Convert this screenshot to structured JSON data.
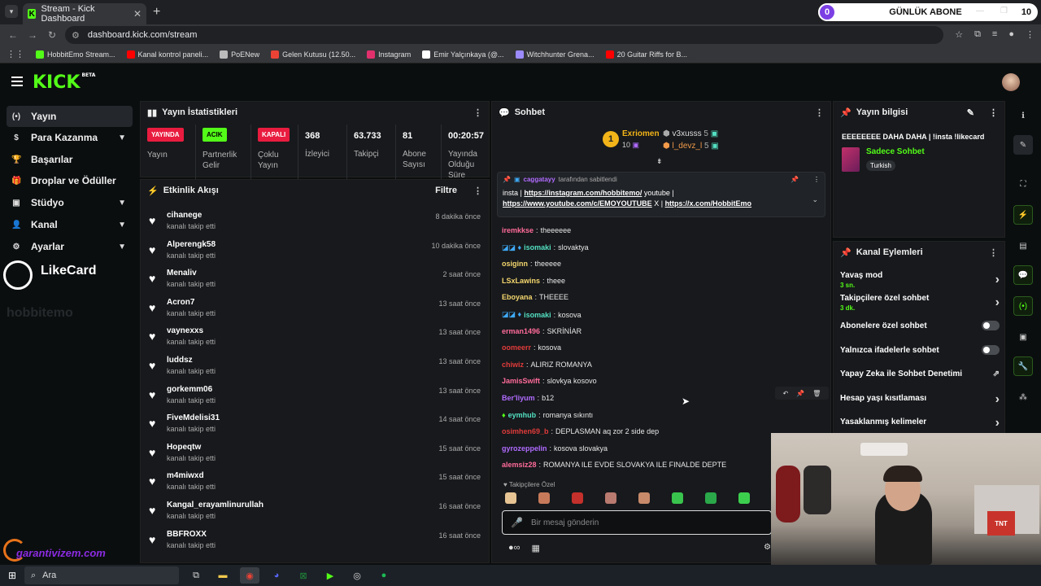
{
  "browser": {
    "tab_title": "Stream - Kick Dashboard",
    "url": "dashboard.kick.com/stream",
    "subscriber_pill": {
      "count": "0",
      "label": "GÜNLÜK ABONE",
      "target": "10"
    },
    "bookmarks": [
      {
        "label": "HobbitEmo Stream...",
        "color": "#53fc18"
      },
      {
        "label": "Kanal kontrol paneli...",
        "color": "#ff0000"
      },
      {
        "label": "PoENew",
        "color": "#bbbbbb"
      },
      {
        "label": "Gelen Kutusu (12.50...",
        "color": "#ea4335"
      },
      {
        "label": "Instagram",
        "color": "#e1306c"
      },
      {
        "label": "Emir Yalçınkaya (@...",
        "color": "#ffffff"
      },
      {
        "label": "Witchhunter Grena...",
        "color": "#9b8bff"
      },
      {
        "label": "20 Guitar Riffs for B...",
        "color": "#ff0000"
      }
    ]
  },
  "kick": {
    "logo": "KICK",
    "logo_badge": "BETA"
  },
  "sidebar": {
    "items": [
      {
        "label": "Yayın",
        "icon": "broadcast-icon",
        "glyph": "(•)",
        "chevron": ""
      },
      {
        "label": "Para Kazanma",
        "icon": "dollar-icon",
        "glyph": "$",
        "chevron": "▼"
      },
      {
        "label": "Başarılar",
        "icon": "trophy-icon",
        "glyph": "🏆",
        "chevron": ""
      },
      {
        "label": "Droplar ve Ödüller",
        "icon": "gift-icon",
        "glyph": "🎁",
        "chevron": ""
      },
      {
        "label": "Stüdyo",
        "icon": "studio-icon",
        "glyph": "▣",
        "chevron": "▼"
      },
      {
        "label": "Kanal",
        "icon": "user-icon",
        "glyph": "👤",
        "chevron": "▼"
      },
      {
        "label": "Ayarlar",
        "icon": "gear-icon",
        "glyph": "⚙",
        "chevron": "▼"
      }
    ],
    "likecard_text": "LikeCard",
    "watermark_text": "hobbitemo",
    "garanti_text": "garantivizem.com"
  },
  "stats": {
    "title": "Yayın İstatistikleri",
    "cells": [
      {
        "badge": "YAYINDA",
        "badge_color": "#e91c3f",
        "label": "Yayın"
      },
      {
        "badge": "ACIK",
        "badge_color": "#53fc18",
        "label": "Partnerlik Gelir"
      },
      {
        "badge": "KAPALI",
        "badge_color": "#e91c3f",
        "label": "Çoklu Yayın"
      },
      {
        "value": "368",
        "label": "İzleyici"
      },
      {
        "value": "63.733",
        "label": "Takipçi"
      },
      {
        "value": "81",
        "label": "Abone Sayısı"
      },
      {
        "value": "00:20:57",
        "label": "Yayında Olduğu Süre"
      }
    ]
  },
  "activity": {
    "title": "Etkinlik Akışı",
    "filter_label": "Filtre",
    "items": [
      {
        "name": "cihanege",
        "action": "kanalı takip etti",
        "time": "8 dakika önce"
      },
      {
        "name": "Alperengk58",
        "action": "kanalı takip etti",
        "time": "10 dakika önce"
      },
      {
        "name": "Menaliv",
        "action": "kanalı takip etti",
        "time": "2 saat önce"
      },
      {
        "name": "Acron7",
        "action": "kanalı takip etti",
        "time": "13 saat önce"
      },
      {
        "name": "vaynexxs",
        "action": "kanalı takip etti",
        "time": "13 saat önce"
      },
      {
        "name": "luddsz",
        "action": "kanalı takip etti",
        "time": "13 saat önce"
      },
      {
        "name": "gorkemm06",
        "action": "kanalı takip etti",
        "time": "13 saat önce"
      },
      {
        "name": "FiveMdelisi31",
        "action": "kanalı takip etti",
        "time": "14 saat önce"
      },
      {
        "name": "Hopeqtw",
        "action": "kanalı takip etti",
        "time": "15 saat önce"
      },
      {
        "name": "m4miwxd",
        "action": "kanalı takip etti",
        "time": "15 saat önce"
      },
      {
        "name": "Kangal_erayamlinurullah",
        "action": "kanalı takip etti",
        "time": "16 saat önce"
      },
      {
        "name": "BBFROXX",
        "action": "kanalı takip etti",
        "time": "16 saat önce"
      }
    ]
  },
  "chat": {
    "title": "Sohbet",
    "leaderboard": {
      "first_name": "Exriomen",
      "first_count": "10",
      "second_name": "v3xusss",
      "second_count": "5",
      "third_name": "l_devz_l",
      "third_count": "5"
    },
    "pinned": {
      "user": "caggatayy",
      "suffix": "tarafından sabitlendi",
      "text_prefix": "insta |",
      "link1": "https://instagram.com/hobbitemo/",
      "text_mid": "youtube |",
      "link2": "https://www.youtube.com/c/EMOYOUTUBE",
      "text_x": "X |",
      "link3": "https://x.com/HobbitEmo"
    },
    "messages": [
      {
        "user": "iremkkse",
        "color": "#ff6b9a",
        "text": "theeeeee",
        "badges": false
      },
      {
        "user": "isomaki",
        "color": "#53e0c2",
        "text": "slovaktya",
        "badges": true
      },
      {
        "user": "osiginn",
        "color": "#f5d76e",
        "text": "theeeee",
        "badges": false
      },
      {
        "user": "LSxLawins",
        "color": "#f5d76e",
        "text": "theee",
        "badges": false
      },
      {
        "user": "Eboyana",
        "color": "#f5d76e",
        "text": "THEEEE",
        "badges": false
      },
      {
        "user": "isomaki",
        "color": "#53e0c2",
        "text": "kosova",
        "badges": true
      },
      {
        "user": "erman1496",
        "color": "#ff6b9a",
        "text": "SKRİNİAR",
        "badges": false
      },
      {
        "user": "oomeerr",
        "color": "#e13b3b",
        "text": "kosova",
        "badges": false
      },
      {
        "user": "chiwiz",
        "color": "#e13b3b",
        "text": "ALIRIZ ROMANYA",
        "badges": false
      },
      {
        "user": "JamisSwift",
        "color": "#ff6b9a",
        "text": "slovkya kosovo",
        "badges": false
      },
      {
        "user": "Ber'liyum",
        "color": "#b06bff",
        "text": "b12",
        "badges": false
      },
      {
        "user": "eymhub",
        "color": "#53e0c2",
        "text": "romanya sıkıntı",
        "badges": false
      },
      {
        "user": "osimhen69_b",
        "color": "#e13b3b",
        "text": "DEPLASMAN aq zor 2 side dep",
        "badges": false
      },
      {
        "user": "gyrozeppelin",
        "color": "#b06bff",
        "text": "kosova slovakya",
        "badges": false
      },
      {
        "user": "alemsiz28",
        "color": "#ff6b9a",
        "text": "ROMANYA ILE EVDE SLOVAKYA ILE FINALDE DEPTE",
        "badges": false
      }
    ],
    "followers_only_label": "Takipçilere Özel",
    "input_placeholder": "Bir mesaj gönderin"
  },
  "stream_info": {
    "title": "Yayın bilgisi",
    "stream_title": "EEEEEEEE DAHA DAHA | !insta !likecard",
    "category": "Sadece Sohbet",
    "language": "Turkish"
  },
  "channel_actions": {
    "title": "Kanal Eylemleri",
    "rows": [
      {
        "label": "Yavaş mod",
        "sub": "3 sn.",
        "control": "chevron"
      },
      {
        "label": "Takipçilere özel sohbet",
        "sub": "3 dk.",
        "control": "chevron"
      },
      {
        "label": "Abonelere özel sohbet",
        "sub": "",
        "control": "toggle"
      },
      {
        "label": "Yalnızca ifadelerle sohbet",
        "sub": "",
        "control": "toggle"
      },
      {
        "label": "Yapay Zeka ile Sohbet Denetimi",
        "sub": "",
        "control": "external"
      },
      {
        "label": "Hesap yaşı kısıtlaması",
        "sub": "",
        "control": "chevron"
      },
      {
        "label": "Yasaklanmış kelimeler",
        "sub": "",
        "control": "chevron"
      }
    ]
  },
  "webcam": {
    "box_text": "TNT"
  },
  "taskbar": {
    "search_label": "Ara"
  }
}
